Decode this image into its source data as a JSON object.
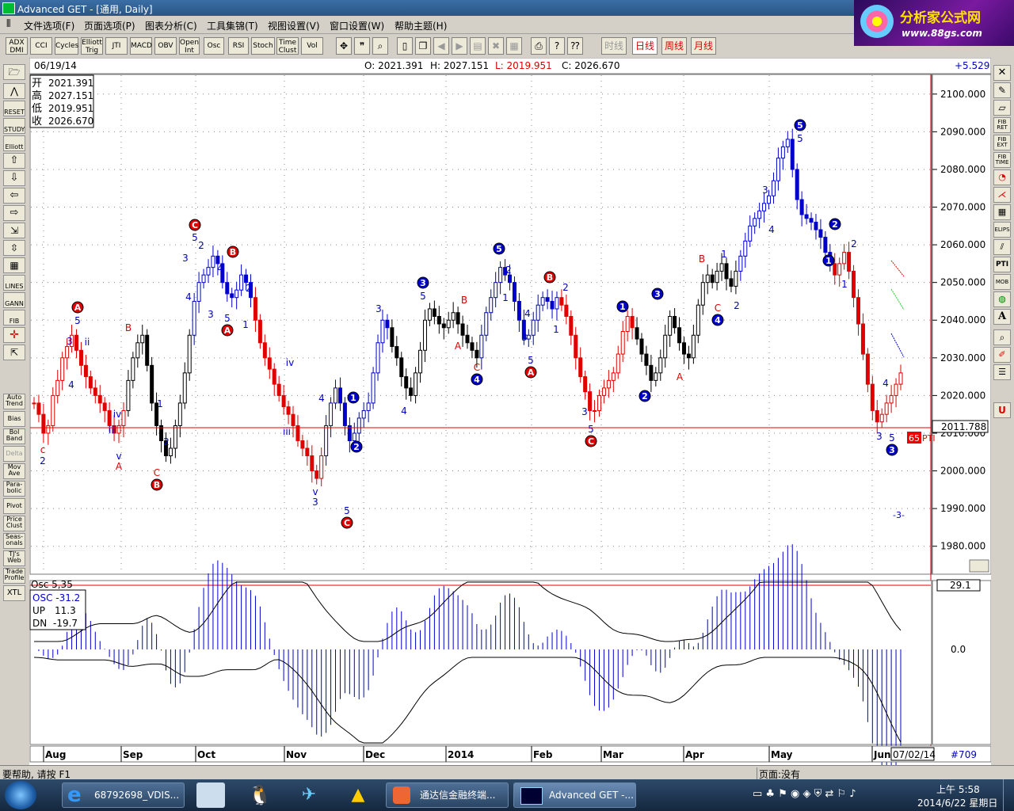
{
  "window": {
    "title": "Advanced GET - [通用, Daily]"
  },
  "menu": [
    "文件选项(F)",
    "页面选项(P)",
    "图表分析(C)",
    "工具集锦(T)",
    "视图设置(V)",
    "窗口设置(W)",
    "帮助主题(H)"
  ],
  "logo": {
    "line1": "分析家公式网",
    "line2": "www.88gs.com"
  },
  "toolbar": {
    "indicators": [
      "ADX DMI",
      "CCI",
      "Cycles",
      "Elliott Trig",
      "JTI",
      "MACD",
      "OBV",
      "Open Int",
      "Osc",
      "RSI",
      "Stoch",
      "Time Clust",
      "Vol"
    ],
    "periods": [
      "时线",
      "日线",
      "周线",
      "月线"
    ]
  },
  "left_tools": [
    "RESET",
    "STUDY",
    "Elliott",
    "LINES",
    "GANN",
    "FIB",
    "Auto Trend",
    "Bias",
    "Bol Band",
    "Delta",
    "Mov Ave",
    "Para-bolic",
    "Pivot",
    "Price Clust",
    "Seas-onals",
    "TJ's Web",
    "Trade Profile",
    "XTL"
  ],
  "right_tools": [
    "FIB RET",
    "FIB EXT",
    "FIB TIME",
    "ELIPS",
    "PTI",
    "MOB",
    "A"
  ],
  "chart_header": {
    "date": "06/19/14",
    "open": "O: 2021.391",
    "high": "H: 2027.151",
    "low": "L: 2019.951",
    "close": "C: 2026.670",
    "change": "+5.529"
  },
  "ohlc_box": [
    {
      "label": "开",
      "value": "2021.391"
    },
    {
      "label": "高",
      "value": "2027.151"
    },
    {
      "label": "低",
      "value": "2019.951"
    },
    {
      "label": "收",
      "value": "2026.670"
    }
  ],
  "price_axis": {
    "ticks": [
      "2100.000",
      "2090.000",
      "2080.000",
      "2070.000",
      "2060.000",
      "2050.000",
      "2040.000",
      "2030.000",
      "2020.000",
      "2010.000",
      "2000.000",
      "1990.000",
      "1980.000"
    ],
    "current": "2011.788"
  },
  "osc": {
    "title": "Osc 5,35",
    "osc": "OSC -31.2",
    "up_label": "UP",
    "up": "11.3",
    "dn_label": "DN",
    "dn": "-19.7",
    "axis_top": "29.1",
    "axis_zero": "0.0"
  },
  "time_axis": {
    "labels": [
      "Aug",
      "Sep",
      "Oct",
      "Nov",
      "Dec",
      "2014",
      "Feb",
      "Mar",
      "Apr",
      "May",
      "Jun"
    ],
    "end_date": "07/02/14",
    "count": "#709"
  },
  "pti": {
    "value": "65",
    "label": "PTI"
  },
  "target_label": "-3-",
  "status": {
    "help": "要帮助, 请按 F1",
    "page": "页面:没有"
  },
  "taskbar": {
    "tasks": [
      "68792698_VDIS...",
      "通达信金融终端...",
      "Advanced GET -..."
    ],
    "time": "上午 5:58",
    "date": "2014/6/22 星期日"
  },
  "colors": {
    "up_wave": "#0000cc",
    "down_wave": "#e00000",
    "neutral": "#000000",
    "accent": "#ff0000"
  },
  "chart_data": {
    "type": "candlestick",
    "ylim": [
      1973,
      2105
    ],
    "close_series": [
      2018,
      2015,
      2010,
      2012,
      2020,
      2024,
      2030,
      2033,
      2036,
      2032,
      2028,
      2025,
      2022,
      2020,
      2018,
      2016,
      2012,
      2010,
      2012,
      2016,
      2024,
      2030,
      2034,
      2036,
      2028,
      2018,
      2012,
      2008,
      2004,
      2006,
      2012,
      2018,
      2026,
      2036,
      2045,
      2050,
      2052,
      2054,
      2057,
      2055,
      2050,
      2047,
      2046,
      2048,
      2052,
      2050,
      2046,
      2040,
      2034,
      2030,
      2027,
      2023,
      2020,
      2017,
      2015,
      2012,
      2008,
      2006,
      2004,
      2000,
      1998,
      2004,
      2012,
      2018,
      2022,
      2018,
      2012,
      2008,
      2010,
      2014,
      2016,
      2018,
      2026,
      2034,
      2040,
      2038,
      2033,
      2030,
      2025,
      2022,
      2020,
      2026,
      2032,
      2040,
      2043,
      2041,
      2039,
      2038,
      2040,
      2042,
      2039,
      2036,
      2034,
      2032,
      2030,
      2036,
      2042,
      2046,
      2050,
      2054,
      2052,
      2050,
      2045,
      2040,
      2035,
      2036,
      2040,
      2044,
      2046,
      2045,
      2043,
      2046,
      2044,
      2041,
      2036,
      2030,
      2025,
      2021,
      2016,
      2016,
      2020,
      2022,
      2024,
      2026,
      2031,
      2037,
      2041,
      2038,
      2035,
      2031,
      2028,
      2024,
      2026,
      2030,
      2036,
      2041,
      2038,
      2034,
      2031,
      2030,
      2036,
      2044,
      2050,
      2052,
      2050,
      2053,
      2055,
      2051,
      2049,
      2053,
      2057,
      2061,
      2065,
      2067,
      2069,
      2071,
      2073,
      2077,
      2083,
      2086,
      2088,
      2080,
      2072,
      2068,
      2067,
      2066,
      2064,
      2062,
      2058,
      2055,
      2052,
      2055,
      2058,
      2053,
      2046,
      2039,
      2031,
      2023,
      2016,
      2013,
      2015,
      2018,
      2020,
      2023,
      2026
    ],
    "wave_labels": [
      "A",
      "B",
      "C",
      "1",
      "2",
      "3",
      "4",
      "5",
      "i",
      "ii",
      "iii",
      "iv",
      "v"
    ]
  }
}
